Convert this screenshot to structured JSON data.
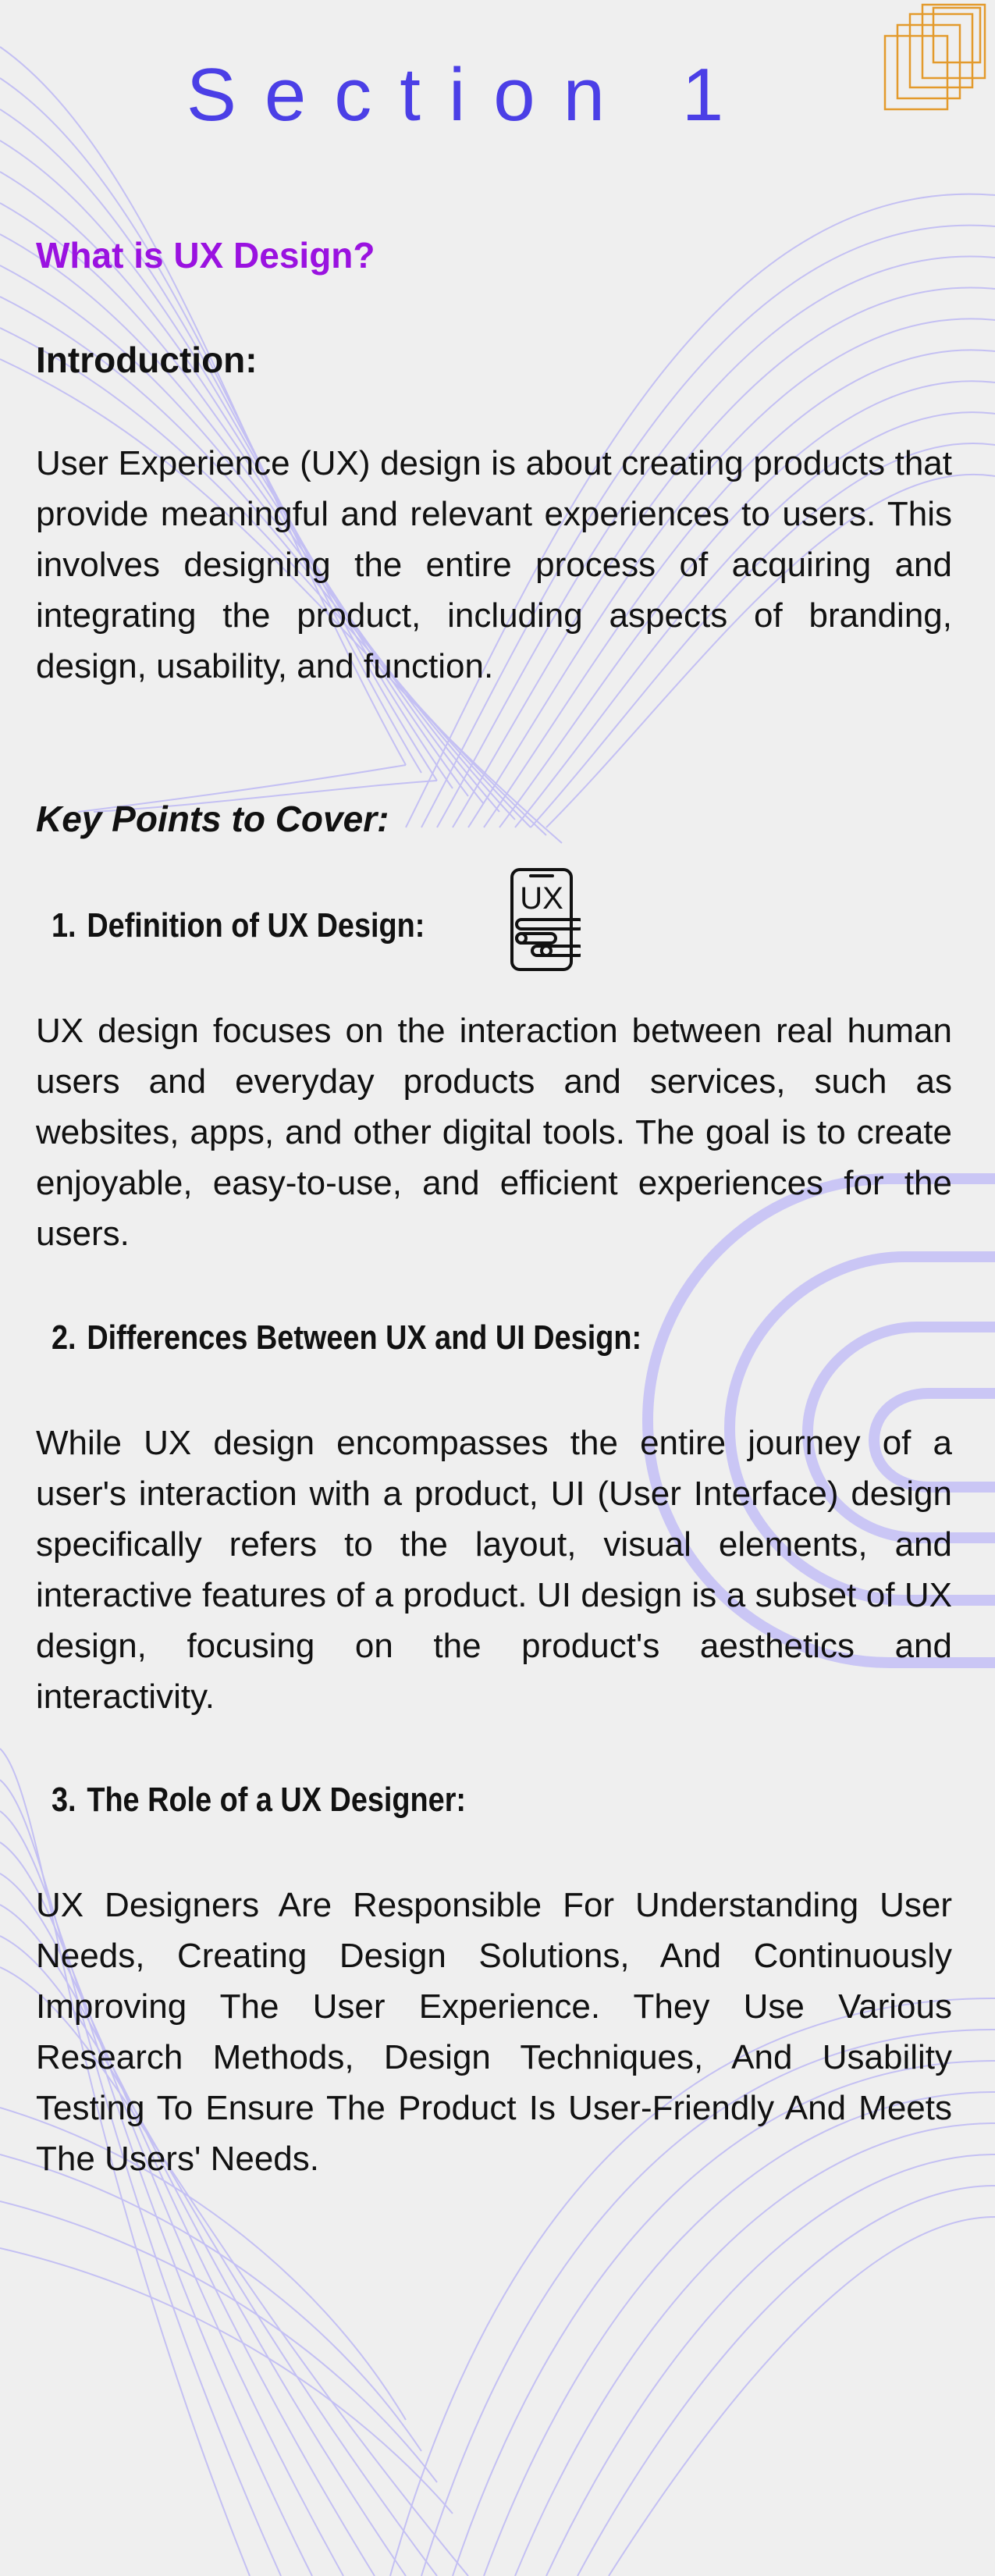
{
  "section_title": "Section 1",
  "page_heading": "What is UX Design?",
  "intro_heading": "Introduction:",
  "intro_text": "User Experience (UX) design is about creating products that provide meaningful and relevant experiences to users. This involves designing the entire process of acquiring and integrating the product, including aspects of branding, design, usability, and function.",
  "key_points_heading": "Key Points to Cover:",
  "items": [
    {
      "number": "1.",
      "title": "Definition of UX Design:",
      "text": "UX design focuses on the interaction between real human users and everyday products and services, such as websites, apps, and other digital tools. The goal is to create enjoyable, easy-to-use, and efficient experiences for the users."
    },
    {
      "number": "2.",
      "title": "Differences Between UX and UI Design:",
      "text": "While UX design encompasses the entire journey of a user's interaction with a product, UI (User Interface) design specifically refers to the layout, visual elements, and interactive features of a product. UI design is a subset of UX design, focusing on the product's aesthetics and interactivity."
    },
    {
      "number": "3.",
      "title": "The Role of a UX Designer:",
      "text": "UX Designers Are Responsible For Understanding User Needs, Creating Design Solutions, And Continuously Improving The User Experience. They Use Various Research Methods, Design Techniques, And Usability Testing To Ensure The Product Is User-Friendly And Meets The Users' Needs."
    }
  ],
  "icon_text": "UX",
  "colors": {
    "background": "#efefef",
    "title": "#4b3fe6",
    "page_heading": "#9a12e0",
    "body_text": "#111111",
    "decor_lines": "#b9b4f2",
    "decor_arcs": "#c9c5f4",
    "corner_squares": "#e39a2c"
  },
  "icons": {
    "ux_icon": "ux-phone-icon",
    "corner": "corner-squares-decoration"
  }
}
